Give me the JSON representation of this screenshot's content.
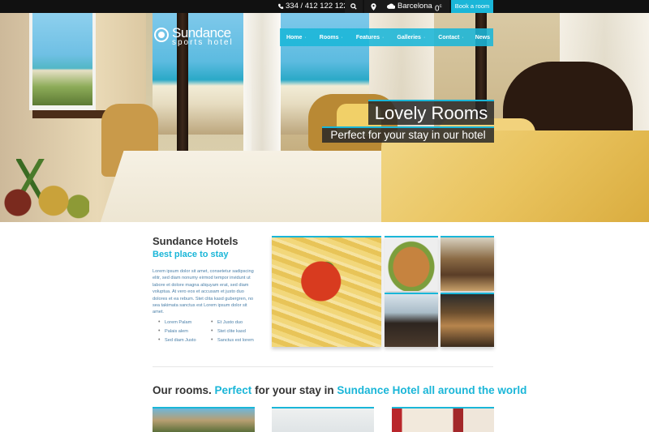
{
  "topbar": {
    "phone": "334 / 412 122 122",
    "city": "Barcelona",
    "temperature": "0",
    "temperature_unit": "c",
    "book_label": "Book a room",
    "icons": [
      "phone-icon",
      "search-icon",
      "location-icon",
      "cloud-icon"
    ]
  },
  "logo": {
    "name": "Sundance",
    "tagline": "sports hotel"
  },
  "nav": {
    "items": [
      {
        "label": "Home",
        "has_dropdown": true
      },
      {
        "label": "Rooms",
        "has_dropdown": true
      },
      {
        "label": "Features",
        "has_dropdown": true
      },
      {
        "label": "Galleries",
        "has_dropdown": true
      },
      {
        "label": "Contact",
        "has_dropdown": true
      },
      {
        "label": "News",
        "has_dropdown": false
      }
    ]
  },
  "hero": {
    "caption_title": "Lovely Rooms",
    "caption_sub": "Perfect for your stay in our hotel"
  },
  "intro": {
    "title": "Sundance Hotels",
    "subtitle": "Best place to stay",
    "body": "Lorem ipsum dolor sit amet, consetetur sadipscing elitr, sed diam nonumy eirmod tempor invidunt ut labore et dolore magna aliquyam erat, sed diam voluptua. At vero eos et accusam et justo duo dolores et ea rebum. Stet clita kasd gubergren, no sea takimata sanctus est Lorem ipsum dolor sit amet.",
    "bullets_left": [
      "Lorem Palam",
      "Palais alem",
      "Sed diam Justo"
    ],
    "bullets_right": [
      "Et Justo duo",
      "Stet clite kasd",
      "Sanctus est lorem"
    ]
  },
  "rooms_section": {
    "heading_part1": "Our rooms.",
    "heading_part2": "Perfect",
    "heading_part3": "for your stay in",
    "heading_part4": "Sundance Hotel all around the world"
  },
  "colors": {
    "accent": "#1ab6d8",
    "topbar": "#111111"
  }
}
